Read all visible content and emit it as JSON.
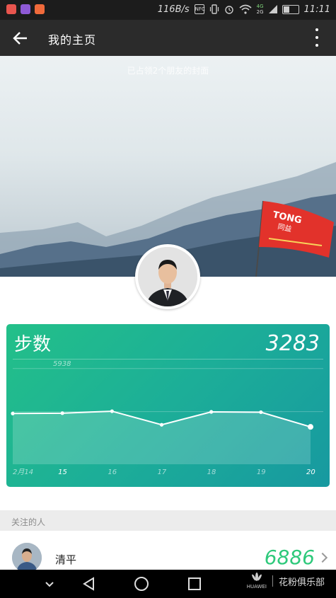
{
  "status_bar": {
    "network_speed": "116B/s",
    "nfc_label": "NFC",
    "network_type_top": "4G",
    "network_type_bottom": "2G",
    "time": "11:11",
    "app_icon_colors": [
      "#e8554e",
      "#8e5ad6",
      "#f06a3b"
    ]
  },
  "app_bar": {
    "title": "我的主页",
    "back_icon": "arrow-left-icon",
    "more_icon": "more-vertical-icon"
  },
  "cover": {
    "caption": "已占领2个朋友的封面",
    "flag_text_main": "TONG",
    "flag_text_sub": "同益",
    "flag_color": "#e2322b"
  },
  "step_card": {
    "label": "步数",
    "value": "3283",
    "max_label": "5938"
  },
  "chart_data": {
    "type": "area",
    "categories": [
      "2月14",
      "15",
      "16",
      "17",
      "18",
      "19",
      "20"
    ],
    "values": [
      3150,
      3170,
      3290,
      2450,
      3250,
      3230,
      2320
    ],
    "max_marker": 5938,
    "ylim": [
      0,
      6500
    ],
    "grid": true,
    "line_color": "#ffffff"
  },
  "following": {
    "header": "关注的人",
    "items": [
      {
        "name": "清平",
        "steps": "6886"
      }
    ]
  },
  "nav_bar": {
    "brand": "花粉俱乐部",
    "brand_maker": "HUAWEI"
  }
}
